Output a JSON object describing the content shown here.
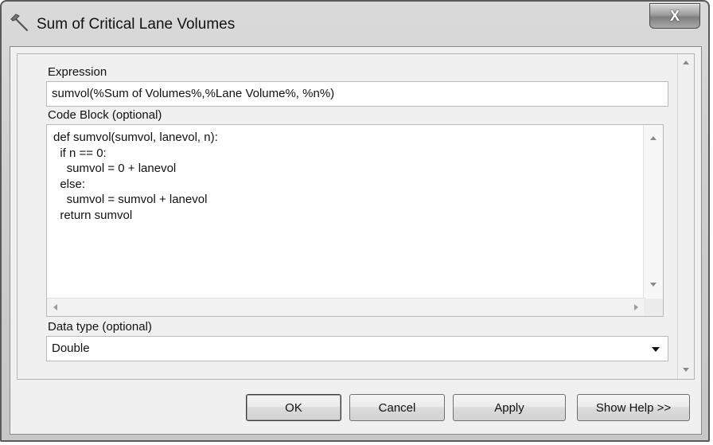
{
  "window": {
    "title": "Sum of Critical Lane Volumes",
    "close_label": "X"
  },
  "expression": {
    "label": "Expression",
    "value": "sumvol(%Sum of Volumes%,%Lane Volume%, %n%)"
  },
  "code_block": {
    "label": "Code Block (optional)",
    "lines": [
      "def sumvol(sumvol, lanevol, n):",
      "  if n == 0:",
      "    sumvol = 0 + lanevol",
      "  else:",
      "    sumvol = sumvol + lanevol",
      "  return sumvol"
    ]
  },
  "data_type": {
    "label": "Data type (optional)",
    "value": "Double"
  },
  "buttons": {
    "ok": "OK",
    "cancel": "Cancel",
    "apply": "Apply",
    "show_help": "Show Help >>"
  },
  "icons": {
    "title": "hammer-icon"
  }
}
